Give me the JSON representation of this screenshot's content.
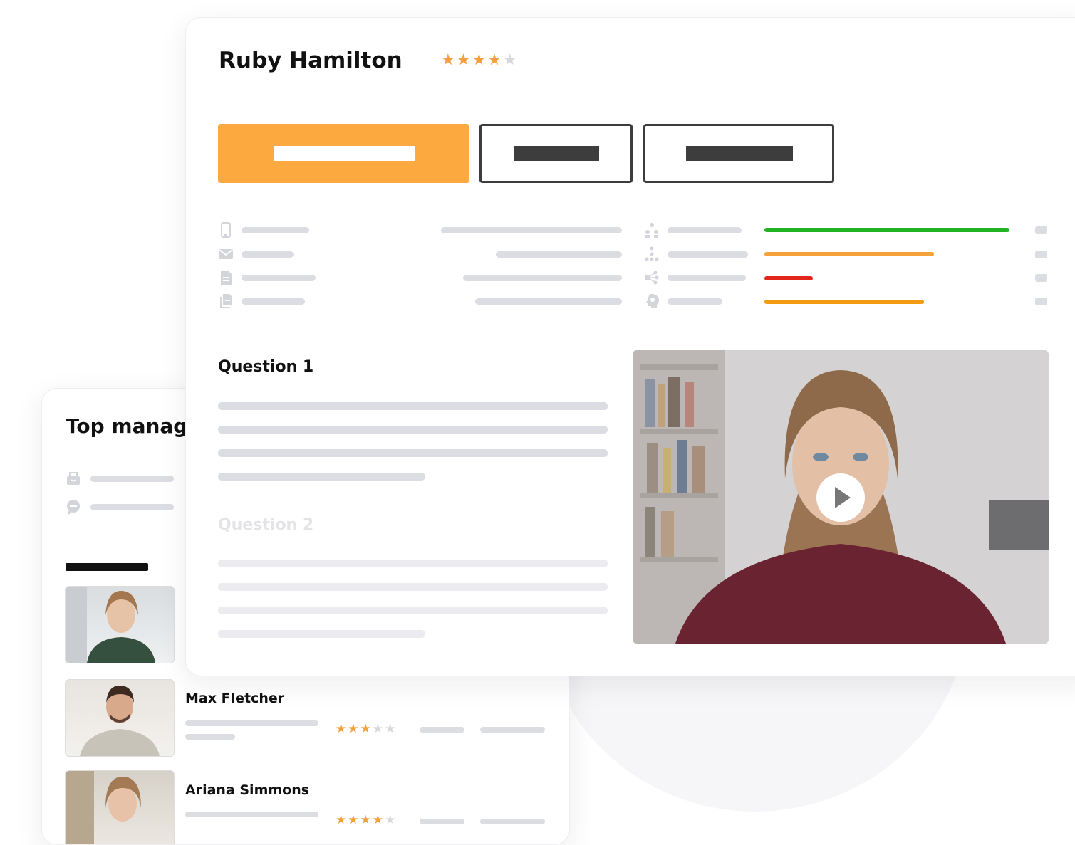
{
  "candidate": {
    "name": "Ruby Hamilton",
    "rating": 4,
    "max_rating": 5
  },
  "tabs": [
    {
      "state": "active"
    },
    {
      "state": "inactive"
    },
    {
      "state": "inactive"
    }
  ],
  "info_icons": [
    "phone-icon",
    "mail-icon",
    "document-icon",
    "documents-icon"
  ],
  "skill_icons": [
    "team-icon",
    "hierarchy-icon",
    "brain-network-icon",
    "head-gear-icon"
  ],
  "skill_bars": [
    {
      "level": 1.0,
      "color": "#22b322"
    },
    {
      "level": 0.69,
      "color": "#f7a13a"
    },
    {
      "level": 0.2,
      "color": "#e2261b"
    },
    {
      "level": 0.65,
      "color": "#f39c12"
    }
  ],
  "questions": [
    {
      "title": "Question 1",
      "active": true
    },
    {
      "title": "Question 2",
      "active": false
    }
  ],
  "video": {
    "icon": "play-icon"
  },
  "back_panel": {
    "title": "Top manag",
    "icons": [
      "inbox-icon",
      "chat-icon"
    ],
    "candidates": [
      {
        "name": "",
        "rating": 0
      },
      {
        "name": "Max Fletcher",
        "rating": 3
      },
      {
        "name": "Ariana Simmons",
        "rating": 4
      }
    ]
  },
  "colors": {
    "accent": "#fcaa40",
    "dark_bar": "#3d3d3d",
    "placeholder": "#dcdce3"
  }
}
